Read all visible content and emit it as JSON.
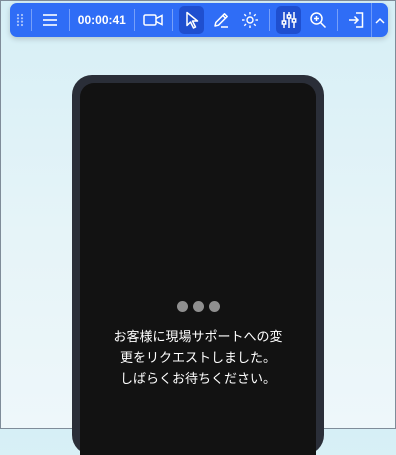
{
  "toolbar": {
    "timer": "00:00:41",
    "icons": [
      "drag-handle-icon",
      "menu-icon",
      "video-camera-icon",
      "cursor-pointer-icon",
      "pencil-icon",
      "sparkle-effect-icon",
      "adjust-sliders-icon",
      "zoom-in-icon",
      "exit-icon",
      "chevron-up-icon"
    ],
    "accent": "#2f6df6",
    "active_bg": "#1f4fcf"
  },
  "phone": {
    "message_lines": [
      "お客様に現場サポートへの変",
      "更をリクエストしました。",
      "しばらくお待ちください。"
    ],
    "loading_dots": 3,
    "screen_color": "#121212"
  }
}
